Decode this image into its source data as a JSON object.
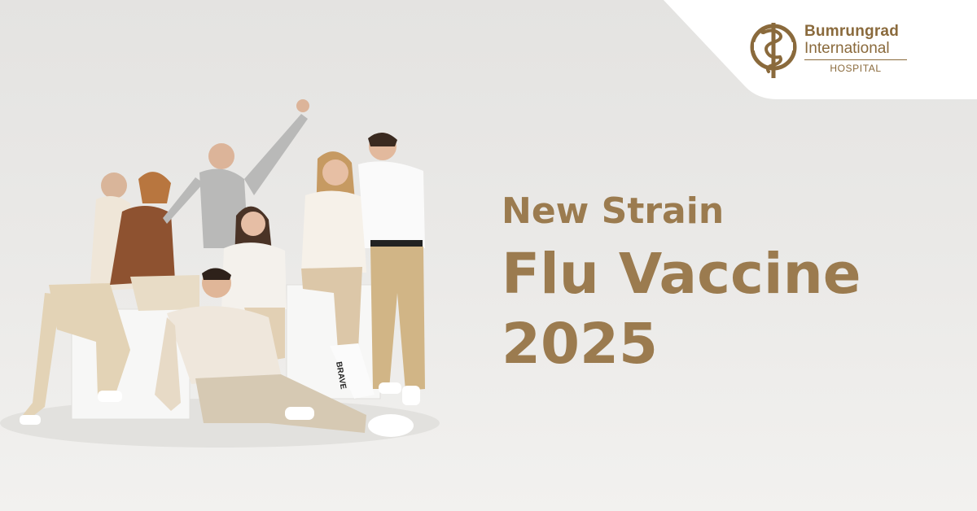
{
  "logo": {
    "name_line1": "Bumrungrad",
    "name_line2": "International",
    "name_line3": "HOSPITAL",
    "icon": "caduceus-icon"
  },
  "headline": {
    "line1": "New Strain",
    "line2": "Flu Vaccine",
    "line3": "2025"
  },
  "photo": {
    "sock_text": "BRAVE"
  },
  "colors": {
    "brand_gold": "#9b7b4f",
    "logo_brown": "#8a6a3c",
    "background": "#ebeae8",
    "corner_panel": "#ffffff"
  }
}
